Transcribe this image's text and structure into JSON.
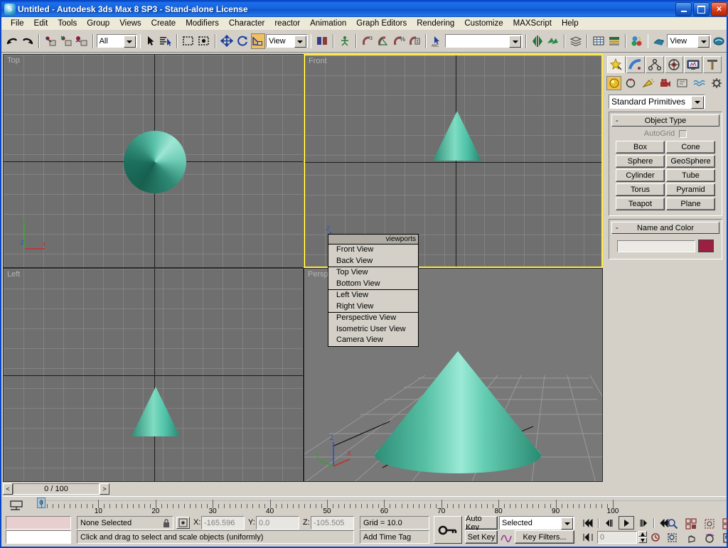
{
  "window": {
    "title": "Untitled - Autodesk 3ds Max 8 SP3  - Stand-alone License",
    "app_icon": "max-logo-icon",
    "minimize": "minimize-icon",
    "maximize": "maximize-icon",
    "close": "close-icon"
  },
  "menubar": {
    "items": [
      {
        "label": "File",
        "accel": "F"
      },
      {
        "label": "Edit",
        "accel": "E"
      },
      {
        "label": "Tools",
        "accel": "T"
      },
      {
        "label": "Group",
        "accel": "G"
      },
      {
        "label": "Views",
        "accel": "V"
      },
      {
        "label": "Create",
        "accel": "C"
      },
      {
        "label": "Modifiers",
        "accel": "d"
      },
      {
        "label": "Character",
        "accel": "h"
      },
      {
        "label": "reactor",
        "accel": ""
      },
      {
        "label": "Animation",
        "accel": "A"
      },
      {
        "label": "Graph Editors",
        "accel": "E"
      },
      {
        "label": "Rendering",
        "accel": "R"
      },
      {
        "label": "Customize",
        "accel": "u"
      },
      {
        "label": "MAXScript",
        "accel": "M"
      },
      {
        "label": "Help",
        "accel": "H"
      }
    ]
  },
  "toolbar": {
    "undo": "undo-icon",
    "redo": "redo-icon",
    "select_and_link": "select-and-link-icon",
    "unlink_selection": "unlink-selection-icon",
    "bind_to_space_warp": "bind-to-space-warp-icon",
    "selection_filter_value": "All",
    "select_object": "select-object-icon",
    "select_by_name": "select-by-name-icon",
    "rectangular_region": "rectangular-selection-region-icon",
    "window_crossing": "window-crossing-icon",
    "select_and_move": "select-and-move-icon",
    "select_and_rotate": "select-and-rotate-icon",
    "select_and_scale": "select-and-uniform-scale-icon",
    "reference_coordinate_system": "View",
    "use_pivot_point_center": "use-pivot-point-center-icon",
    "select_and_manipulate": "select-and-manipulate-icon",
    "snap_toggle": "snaps-toggle-icon",
    "angle_snap": "angle-snap-toggle-icon",
    "percent_snap": "percent-snap-toggle-icon",
    "spinner_snap": "spinner-snap-toggle-icon",
    "named_selection_sets": "named-selection-sets-icon",
    "named_selection_value": "",
    "mirror": "mirror-icon",
    "align": "align-icon",
    "layer_manager": "layer-manager-icon",
    "curve_editor": "curve-editor-icon",
    "schematic_view": "schematic-view-icon",
    "material_editor": "material-editor-icon",
    "render_scene": "render-scene-dialog-icon",
    "render_type_value": "View",
    "quick_render": "quick-render-icon"
  },
  "viewports": [
    {
      "label": "Top",
      "active": false
    },
    {
      "label": "Front",
      "active": true
    },
    {
      "label": "Left",
      "active": false
    },
    {
      "label": "Perspective",
      "active": false
    }
  ],
  "axis_tripod": {
    "x": "X",
    "y": "Y",
    "z": "Z"
  },
  "context_menu": {
    "title": "viewports",
    "groups": [
      [
        {
          "label": "Front View",
          "accel": "F"
        },
        {
          "label": "Back View",
          "accel": "k"
        }
      ],
      [
        {
          "label": "Top View",
          "accel": "T"
        },
        {
          "label": "Bottom View",
          "accel": "B"
        }
      ],
      [
        {
          "label": "Left View",
          "accel": "L"
        },
        {
          "label": "Right View",
          "accel": "R"
        }
      ],
      [
        {
          "label": "Perspective View",
          "accel": "P"
        },
        {
          "label": "Isometric User View",
          "accel": "U"
        },
        {
          "label": "Camera View",
          "accel": "C"
        }
      ]
    ]
  },
  "command_panel": {
    "tabs": [
      {
        "name": "create-tab",
        "icon": "create-star-icon",
        "on": true
      },
      {
        "name": "modify-tab",
        "icon": "modify-arc-icon",
        "on": false
      },
      {
        "name": "hierarchy-tab",
        "icon": "hierarchy-icon",
        "on": false
      },
      {
        "name": "motion-tab",
        "icon": "motion-wheel-icon",
        "on": false
      },
      {
        "name": "display-tab",
        "icon": "display-monitor-icon",
        "on": false
      },
      {
        "name": "utilities-tab",
        "icon": "utilities-hammer-icon",
        "on": false
      }
    ],
    "category_buttons": [
      {
        "name": "geometry-button",
        "icon": "geometry-sphere-icon",
        "on": true
      },
      {
        "name": "shapes-button",
        "icon": "shapes-icon",
        "on": false
      },
      {
        "name": "lights-button",
        "icon": "lights-icon",
        "on": false
      },
      {
        "name": "cameras-button",
        "icon": "camera-icon",
        "on": false
      },
      {
        "name": "helpers-button",
        "icon": "helpers-icon",
        "on": false
      },
      {
        "name": "space-warps-button",
        "icon": "space-warps-icon",
        "on": false
      },
      {
        "name": "systems-button",
        "icon": "systems-gear-icon",
        "on": false
      }
    ],
    "category_value": "Standard Primitives",
    "object_type": {
      "header": "Object Type",
      "collapse": "-",
      "autogrid_label": "AutoGrid",
      "autogrid_checked": false,
      "buttons": [
        "Box",
        "Cone",
        "Sphere",
        "GeoSphere",
        "Cylinder",
        "Tube",
        "Torus",
        "Pyramid",
        "Teapot",
        "Plane"
      ]
    },
    "name_and_color": {
      "header": "Name and Color",
      "collapse": "-",
      "name_value": "",
      "color": "#9c1f42"
    }
  },
  "timeline": {
    "prev_frame": "<",
    "next_frame": ">",
    "current_frame_label": "0 / 100",
    "key_mode_icon": "key-mode-toggle-icon",
    "tick_labels": [
      "0",
      "10",
      "20",
      "30",
      "40",
      "50",
      "60",
      "70",
      "80",
      "90",
      "100"
    ],
    "slider_label": "0"
  },
  "status": {
    "selection_text": "None Selected",
    "lock_icon": "selection-lock-icon",
    "coord_icon": "absolute-relative-transform-icon",
    "x_label": "X:",
    "x_value": "-165.596",
    "y_label": "Y:",
    "y_value": "0.0",
    "z_label": "Z:",
    "z_value": "-105.505",
    "grid_text": "Grid = 10.0",
    "time_tag": "Add Time Tag",
    "prompt": "Click and drag to select and scale objects (uniformly)",
    "key_icon": "key-toggle-icon",
    "auto_key": "Auto Key",
    "set_key": "Set Key",
    "key_filter_set": "Selected",
    "key_filters": "Key Filters...",
    "curve_icon": "parameter-curve-icon"
  },
  "playback": {
    "go_to_start": "go-to-start-icon",
    "previous_frame": "previous-frame-icon",
    "play": "play-animation-icon",
    "next_frame": "next-frame-icon",
    "go_to_end": "go-to-end-icon",
    "key_mode": "key-mode-toggle-icon",
    "frame_value": "0",
    "time_config": "time-configuration-icon"
  },
  "view_controls": {
    "zoom": "zoom-icon",
    "zoom_all": "zoom-all-icon",
    "zoom_extents": "zoom-extents-icon",
    "zoom_extents_all": "zoom-extents-all-icon",
    "zoom_region": "zoom-region-icon",
    "pan": "pan-view-icon",
    "arc_rotate": "arc-rotate-icon",
    "maximize_viewport": "maximize-viewport-toggle-icon"
  },
  "colors": {
    "object_teal": "#4fc2a8",
    "viewport_bg": "#6f6f6f",
    "active_border": "#ffec40",
    "title_blue": "#1565dc"
  }
}
